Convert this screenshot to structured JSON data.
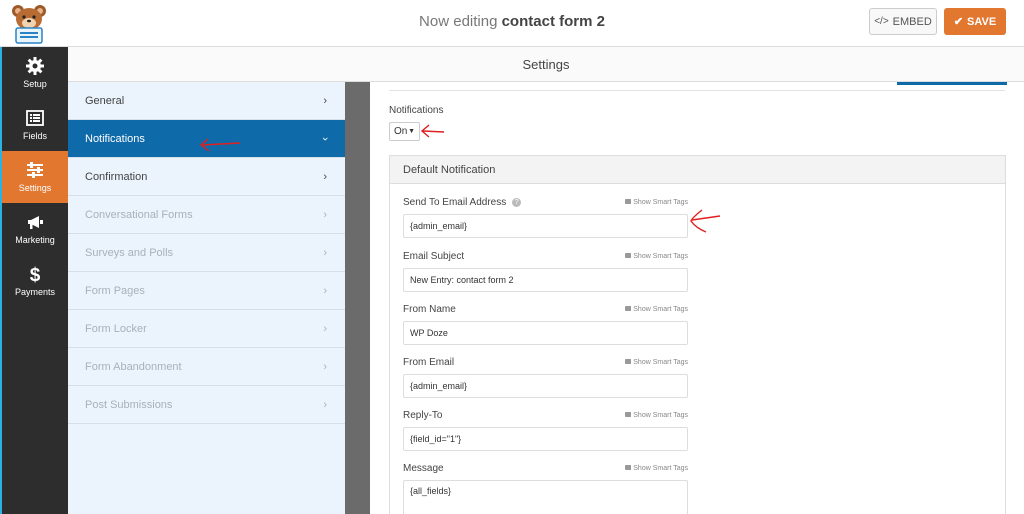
{
  "header": {
    "title_prefix": "Now editing ",
    "form_name": "contact form 2",
    "embed_label": "EMBED",
    "save_label": "SAVE"
  },
  "leftnav": [
    {
      "label": "Setup",
      "icon": "gear-icon"
    },
    {
      "label": "Fields",
      "icon": "list-icon"
    },
    {
      "label": "Settings",
      "icon": "sliders-icon",
      "active": true
    },
    {
      "label": "Marketing",
      "icon": "megaphone-icon"
    },
    {
      "label": "Payments",
      "icon": "dollar-icon"
    }
  ],
  "settings_title": "Settings",
  "submenu": [
    {
      "label": "General"
    },
    {
      "label": "Notifications",
      "active": true
    },
    {
      "label": "Confirmation"
    },
    {
      "label": "Conversational Forms",
      "disabled": true
    },
    {
      "label": "Surveys and Polls",
      "disabled": true
    },
    {
      "label": "Form Pages",
      "disabled": true
    },
    {
      "label": "Form Locker",
      "disabled": true
    },
    {
      "label": "Form Abandonment",
      "disabled": true
    },
    {
      "label": "Post Submissions",
      "disabled": true
    }
  ],
  "notifications": {
    "label": "Notifications",
    "value": "On"
  },
  "panel": {
    "title": "Default Notification",
    "smart_tags_label": "Show Smart Tags",
    "fields": [
      {
        "label": "Send To Email Address",
        "value": "{admin_email}",
        "help": true
      },
      {
        "label": "Email Subject",
        "value": "New Entry: contact form 2"
      },
      {
        "label": "From Name",
        "value": "WP Doze"
      },
      {
        "label": "From Email",
        "value": "{admin_email}"
      },
      {
        "label": "Reply-To",
        "value": "{field_id=\"1\"}"
      },
      {
        "label": "Message",
        "value": "{all_fields}"
      }
    ]
  },
  "colors": {
    "accent": "#e27730",
    "nav_bg": "#2d2d2d",
    "submenu_active": "#0e6aa8",
    "annotation": "#e02020"
  }
}
